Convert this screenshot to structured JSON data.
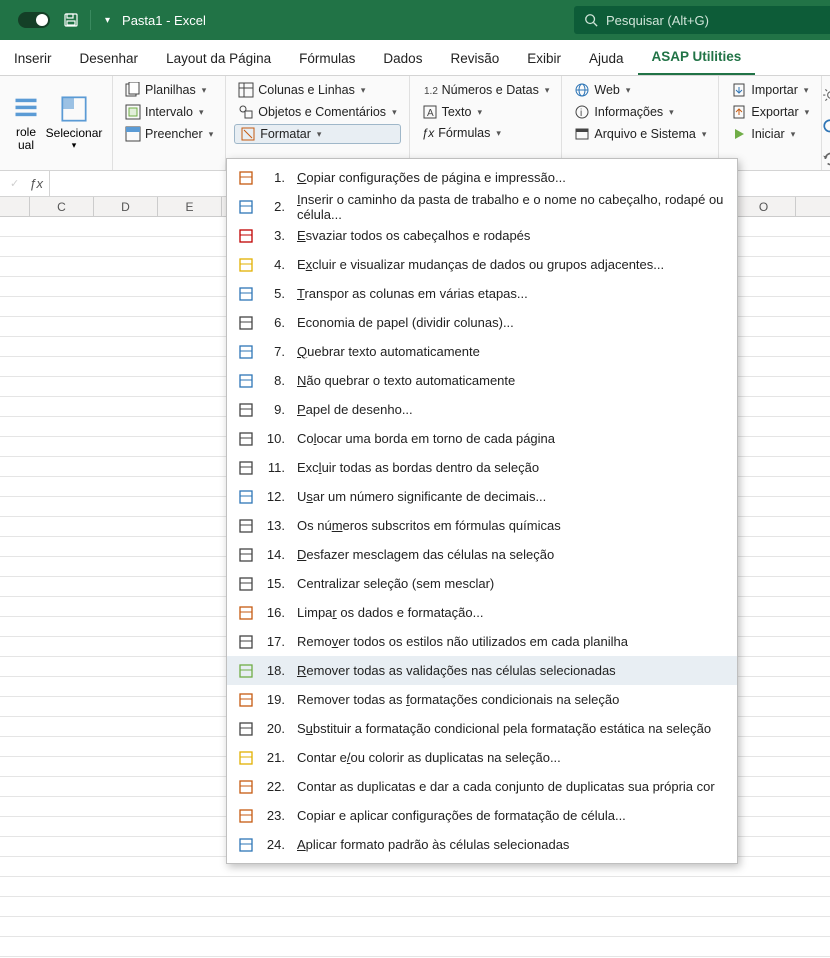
{
  "titlebar": {
    "title": "Pasta1 - Excel",
    "search_placeholder": "Pesquisar (Alt+G)"
  },
  "tabs": [
    "Inserir",
    "Desenhar",
    "Layout da Página",
    "Fórmulas",
    "Dados",
    "Revisão",
    "Exibir",
    "Ajuda",
    "ASAP Utilities"
  ],
  "active_tab": "ASAP Utilities",
  "ribbon": {
    "group0": {
      "big1": "role",
      "big1_sub": "ual",
      "big2": "Selecionar"
    },
    "group1": {
      "a": "Planilhas",
      "b": "Intervalo",
      "c": "Preencher"
    },
    "group2": {
      "a": "Colunas e Linhas",
      "b": "Objetos e Comentários",
      "c": "Formatar"
    },
    "group3": {
      "a": "Números e Datas",
      "b": "Texto",
      "c": "Fórmulas"
    },
    "group4": {
      "a": "Web",
      "b": "Informações",
      "c": "Arquivo e Sistema"
    },
    "group5": {
      "a": "Importar",
      "b": "Exportar",
      "c": "Iniciar"
    }
  },
  "columns": [
    "",
    "C",
    "D",
    "E",
    "",
    "",
    "",
    "",
    "",
    "",
    "",
    "O"
  ],
  "menu": [
    {
      "n": "1.",
      "u": "C",
      "t": "opiar configurações de página e impressão..."
    },
    {
      "n": "2.",
      "u": "I",
      "t": "nserir o caminho da pasta de trabalho e o nome no cabeçalho, rodapé ou célula..."
    },
    {
      "n": "3.",
      "u": "E",
      "t": "svaziar todos os cabeçalhos e rodapés"
    },
    {
      "n": "4.",
      "u": "",
      "t": "E",
      "u2": "x",
      "t2": "cluir e visualizar mudanças de dados ou grupos adjacentes..."
    },
    {
      "n": "5.",
      "u": "T",
      "t": "ranspor as colunas em várias etapas..."
    },
    {
      "n": "6.",
      "u": "",
      "t": "Economia de papel (dividir colunas)..."
    },
    {
      "n": "7.",
      "u": "Q",
      "t": "uebrar texto automaticamente"
    },
    {
      "n": "8.",
      "u": "N",
      "t": "ão quebrar o texto automaticamente"
    },
    {
      "n": "9.",
      "u": "P",
      "t": "apel de desenho..."
    },
    {
      "n": "10.",
      "u": "",
      "t": "Co",
      "u2": "l",
      "t2": "ocar uma borda em torno de cada página"
    },
    {
      "n": "11.",
      "u": "",
      "t": "Exc",
      "u2": "l",
      "t2": "uir todas as bordas dentro da seleção"
    },
    {
      "n": "12.",
      "u": "",
      "t": "U",
      "u2": "s",
      "t2": "ar um número significante de decimais..."
    },
    {
      "n": "13.",
      "u": "",
      "t": "Os nú",
      "u2": "m",
      "t2": "eros subscritos em fórmulas químicas"
    },
    {
      "n": "14.",
      "u": "D",
      "t": "esfazer mesclagem das células na seleção"
    },
    {
      "n": "15.",
      "u": "",
      "t": "Centralizar seleção (sem mesclar)"
    },
    {
      "n": "16.",
      "u": "",
      "t": "Limpa",
      "u2": "r",
      "t2": " os dados e formatação..."
    },
    {
      "n": "17.",
      "u": "",
      "t": "Remo",
      "u2": "v",
      "t2": "er todos os estilos não utilizados em cada planilha"
    },
    {
      "n": "18.",
      "u": "R",
      "t": "emover todas as validações nas células selecionadas",
      "hovered": true
    },
    {
      "n": "19.",
      "u": "",
      "t": "Remover todas as ",
      "u2": "f",
      "t2": "ormatações condicionais na seleção"
    },
    {
      "n": "20.",
      "u": "",
      "t": "S",
      "u2": "u",
      "t2": "bstituir a formatação condicional pela formatação estática na seleção"
    },
    {
      "n": "21.",
      "u": "",
      "t": "Contar e",
      "u2": "/",
      "t2": "ou colorir as duplicatas na seleção..."
    },
    {
      "n": "22.",
      "u": "",
      "t": "Contar as duplicatas e dar a cada conjunto de duplicatas sua própria cor"
    },
    {
      "n": "23.",
      "u": "",
      "t": "Copiar e aplicar configurações de formatação de célula..."
    },
    {
      "n": "24.",
      "u": "A",
      "t": "plicar formato padrão às células selecionadas"
    }
  ]
}
